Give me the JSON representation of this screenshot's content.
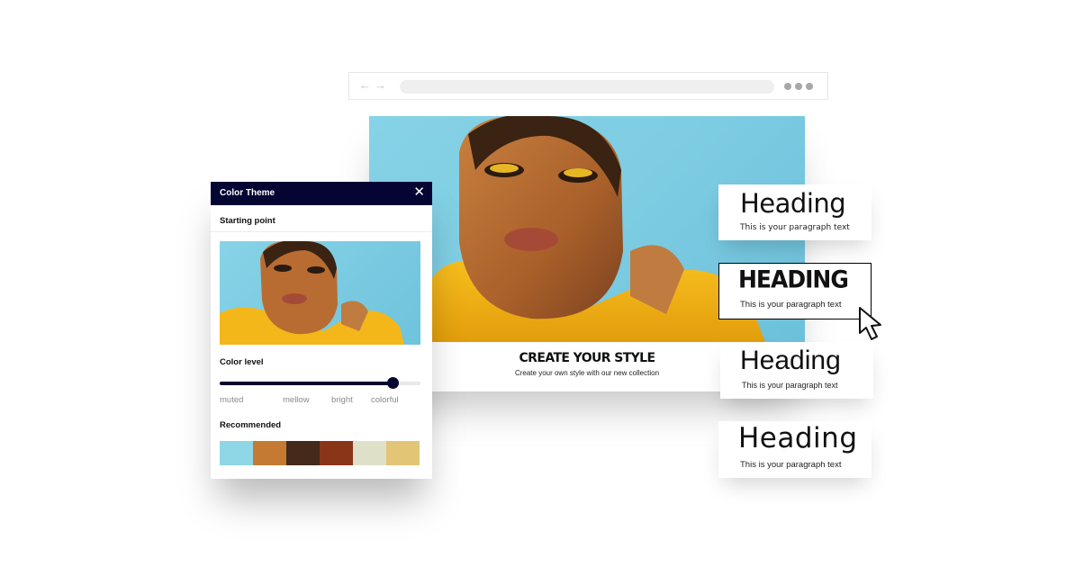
{
  "browser": {
    "back_icon": "arrow-left-icon",
    "forward_icon": "arrow-right-icon",
    "back_glyph": "←",
    "forward_glyph": "→",
    "url_value": "",
    "menu_icon": "more-dots-icon"
  },
  "site": {
    "hero_image": "woman-in-yellow-hoodie-photo",
    "title": "CREATE YOUR STYLE",
    "subtitle": "Create your own style with our new collection"
  },
  "color_theme_panel": {
    "title": "Color Theme",
    "close_glyph": "✕",
    "starting_point_label": "Starting point",
    "starting_image": "woman-in-yellow-hoodie-thumbnail",
    "color_level_label": "Color level",
    "color_level": {
      "value_fraction": 0.86,
      "stops": [
        "muted",
        "mellow",
        "bright",
        "colorful"
      ]
    },
    "recommended_label": "Recommended",
    "palette": [
      "#8fd6e6",
      "#c57a33",
      "#45291a",
      "#8a3517",
      "#dfe0c8",
      "#e3c576"
    ]
  },
  "typography_options": [
    {
      "heading": "Heading",
      "paragraph": "This is your paragraph text",
      "selected": false
    },
    {
      "heading": "HEADING",
      "paragraph": "This is your paragraph text",
      "selected": true
    },
    {
      "heading": "Heading",
      "paragraph": "This is your paragraph text",
      "selected": false
    },
    {
      "heading": "Heading",
      "paragraph": "This is your paragraph text",
      "selected": false
    }
  ],
  "colors": {
    "panel_header": "#050533",
    "sky": "#86d2e6",
    "hoodie": "#f2b318"
  }
}
